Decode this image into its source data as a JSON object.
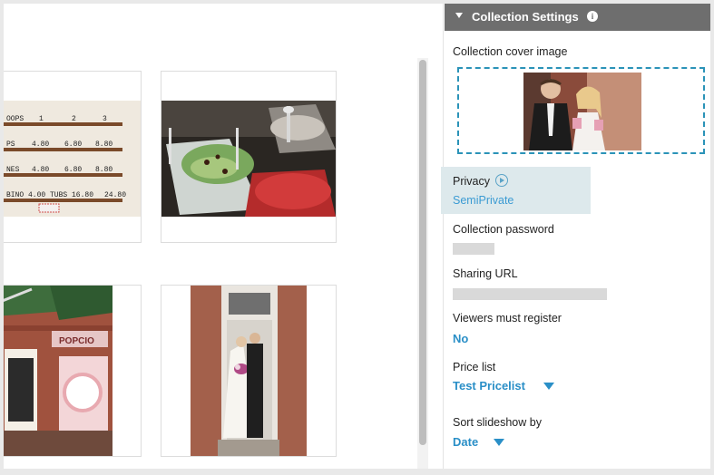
{
  "panel": {
    "header_title": "Collection Settings",
    "cover_label": "Collection cover image",
    "privacy": {
      "label": "Privacy",
      "value": "SemiPrivate"
    },
    "password_label": "Collection password",
    "sharing_label": "Sharing URL",
    "viewers": {
      "label": "Viewers must register",
      "value": "No"
    },
    "price_list": {
      "label": "Price list",
      "value": "Test Pricelist"
    },
    "sort": {
      "label": "Sort slideshow by",
      "value": "Date"
    }
  },
  "gallery": {
    "menu_board": {
      "rows": [
        [
          "OOPS",
          "1",
          "2",
          "3"
        ],
        [
          "PS",
          "4.80",
          "6.80",
          "8.80"
        ],
        [
          "NES",
          "4.80",
          "6.80",
          "8.80"
        ],
        [
          "BINO 4.00",
          "TUBS 16.80",
          "24.80"
        ]
      ]
    },
    "storefront_sign": "POPCIO"
  },
  "colors": {
    "accent": "#2a8fc7",
    "header_bg": "#6e6e6e",
    "privacy_bg": "#dde9ec",
    "dashed_border": "#2b93b8"
  }
}
